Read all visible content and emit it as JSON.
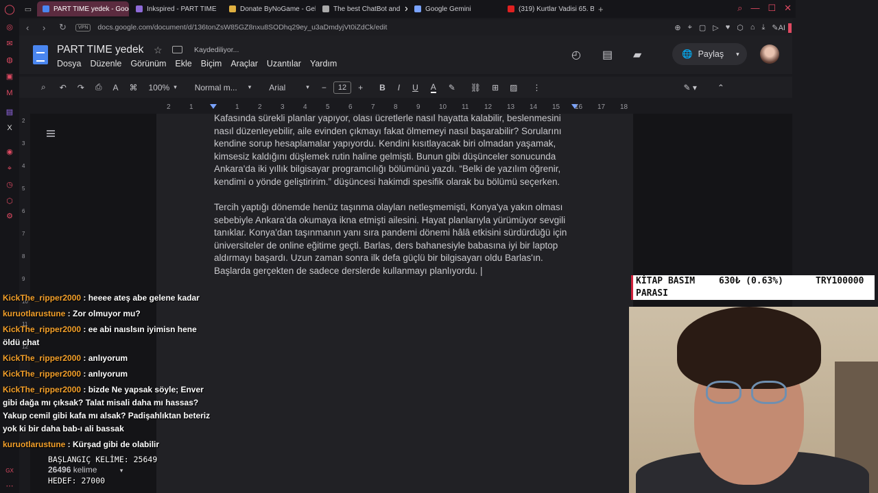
{
  "browser": {
    "tabs": [
      {
        "label": "PART TIME yedek - Google",
        "color": "#4a86f0",
        "active": true
      },
      {
        "label": "Inkspired - PART TIME",
        "color": "#8e6ad8",
        "active": false
      },
      {
        "label": "Donate ByNoGame - Gel",
        "color": "#e0b040",
        "active": false
      },
      {
        "label": "The best ChatBot and",
        "color": "#aaaaaa",
        "active": false
      },
      {
        "label": "Google Gemini",
        "color": "#7aa3ff",
        "active": false
      },
      {
        "label": "(319) Kurtlar Vadisi 65. Bö",
        "color": "#e02020",
        "active": false
      }
    ],
    "url": "docs.google.com/document/d/136tonZsW85GZ8nxu8SODhq29ey_u3aDmdyjVt0iZdCk/edit",
    "vpn": "VPN"
  },
  "doc": {
    "title": "PART TIME yedek",
    "save_status": "Kaydediliyor...",
    "menu": [
      "Dosya",
      "Düzenle",
      "Görünüm",
      "Ekle",
      "Biçim",
      "Araçlar",
      "Uzantılar",
      "Yardım"
    ],
    "share_label": "Paylaş",
    "zoom": "100%",
    "style": "Normal m...",
    "font": "Arial",
    "font_size": "12",
    "ruler": [
      "2",
      "1",
      "1",
      "2",
      "3",
      "4",
      "5",
      "6",
      "7",
      "8",
      "9",
      "10",
      "11",
      "12",
      "13",
      "14",
      "15",
      "16",
      "17",
      "18"
    ],
    "vruler": [
      "2",
      "3",
      "4",
      "5",
      "6",
      "7",
      "8",
      "9",
      "10",
      "11",
      "12"
    ],
    "para1": "Kafasında sürekli planlar yapıyor, olası ücretlerle nasıl hayatta kalabilir, beslenmesini nasıl düzenleyebilir, aile evinden çıkmayı fakat ölmemeyi nasıl başarabilir? Sorularını kendine sorup hesaplamalar yapıyordu. Kendini kısıtlayacak biri olmadan yaşamak, kimsesiz kaldığını düşlemek rutin haline gelmişti. Bunun gibi düşünceler sonucunda Ankara'da iki yıllık bilgisayar programcılığı bölümünü yazdı. “Belki de yazılım öğrenir, kendimi o yönde geliştiririm.” düşüncesi hakimdi spesifik olarak bu bölümü seçerken.",
    "para2": "Tercih yaptığı dönemde henüz taşınma olayları netleşmemişti, Konya'ya yakın olması sebebiyle Ankara'da okumaya ikna etmişti ailesini. Hayat planlarıyla yürümüyor sevgili tanıklar. Konya'dan taşınmanın yanı sıra pandemi dönemi hâlâ etkisini sürdürdüğü için üniversiteler de online eğitime geçti. Barlas, ders bahanesiyle babasına iyi bir laptop aldırmayı başardı. Uzun zaman sonra ilk defa güçlü bir bilgisayarı oldu Barlas'ın. Başlarda gerçekten de sadece derslerde kullanmayı planlıyordu. |"
  },
  "overlay": {
    "goal_label": "KİTAP BASIM",
    "goal_label2": "PARASI",
    "goal_amount": "630₺ (0.63%)",
    "goal_target": "TRY100000",
    "start_words": "BAŞLANGIÇ KELİME: 25649",
    "word_count": "26496",
    "word_unit": "kelime",
    "target_words": "HEDEF: 27000"
  },
  "chat": [
    {
      "user": "KickThe_ripper2000",
      "text": " : heeee ateş abe gelene kadar",
      "color": "#f4a02a"
    },
    {
      "user": "kuruotlarustune",
      "text": " : Zor olmuyor mu?",
      "color": "#f4a02a"
    },
    {
      "user": "KickThe_ripper2000",
      "text": " : ee abi naıslsın iyimisn hene öldü chat",
      "color": "#f4a02a"
    },
    {
      "user": "KickThe_ripper2000",
      "text": " : anlıyorum",
      "color": "#f4a02a"
    },
    {
      "user": "KickThe_ripper2000",
      "text": " : anlıyorum",
      "color": "#f4a02a"
    },
    {
      "user": "KickThe_ripper2000",
      "text": " : bizde Ne yapsak söyle; Enver gibi dağa mı çıksak? Talat misali daha mı hassas? Yakup cemil gibi kafa mı alsak? Padişahlıktan beteriz yok ki bir daha bab-ı ali bassak",
      "color": "#f4a02a"
    },
    {
      "user": "kuruotlarustune",
      "text": " : Kürşad gibi de olabilir",
      "color": "#f4a02a"
    }
  ]
}
